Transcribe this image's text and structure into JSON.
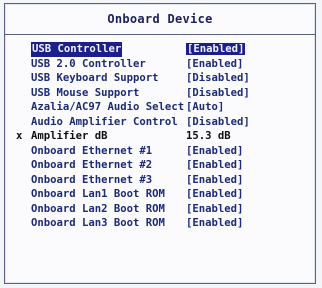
{
  "title": "Onboard Device",
  "items": [
    {
      "label": "USB Controller",
      "value": "[Enabled]",
      "selected": true,
      "mark": "",
      "selectable": true
    },
    {
      "label": "USB 2.0 Controller",
      "value": "[Enabled]",
      "selected": false,
      "mark": "",
      "selectable": true
    },
    {
      "label": "USB Keyboard Support",
      "value": "[Disabled]",
      "selected": false,
      "mark": "",
      "selectable": true
    },
    {
      "label": "USB Mouse Support",
      "value": "[Disabled]",
      "selected": false,
      "mark": "",
      "selectable": true
    },
    {
      "label": "Azalia/AC97 Audio Select",
      "value": "[Auto]",
      "selected": false,
      "mark": "",
      "selectable": true
    },
    {
      "label": "Audio Amplifier Control",
      "value": "[Disabled]",
      "selected": false,
      "mark": "",
      "selectable": true
    },
    {
      "label": "Amplifier dB",
      "value": "15.3 dB",
      "selected": false,
      "mark": "x",
      "selectable": false
    },
    {
      "label": "Onboard Ethernet #1",
      "value": "[Enabled]",
      "selected": false,
      "mark": "",
      "selectable": true
    },
    {
      "label": "Onboard Ethernet #2",
      "value": "[Enabled]",
      "selected": false,
      "mark": "",
      "selectable": true
    },
    {
      "label": "Onboard Ethernet #3",
      "value": "[Enabled]",
      "selected": false,
      "mark": "",
      "selectable": true
    },
    {
      "label": "Onboard Lan1 Boot ROM",
      "value": "[Enabled]",
      "selected": false,
      "mark": "",
      "selectable": true
    },
    {
      "label": "Onboard Lan2 Boot ROM",
      "value": "[Enabled]",
      "selected": false,
      "mark": "",
      "selectable": true
    },
    {
      "label": "Onboard Lan3 Boot ROM",
      "value": "[Enabled]",
      "selected": false,
      "mark": "",
      "selectable": true
    }
  ],
  "colors": {
    "text": "#1c2a78",
    "highlight_bg": "#1b1f8a",
    "highlight_text": "#f2f2ff",
    "border": "#5a5f86"
  }
}
